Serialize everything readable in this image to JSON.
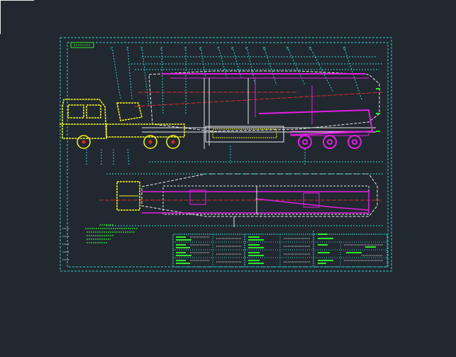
{
  "colors": {
    "background": "#212830",
    "border": "#33d0cc",
    "yellow": "#f2f21a",
    "magenta": "#e21ee2",
    "white": "#e8e8e8",
    "red": "#d82a2a",
    "green": "#2ee82e",
    "cyan": "#33d0cc"
  },
  "drawing": {
    "sheet_label": "",
    "callout_count": 15
  }
}
